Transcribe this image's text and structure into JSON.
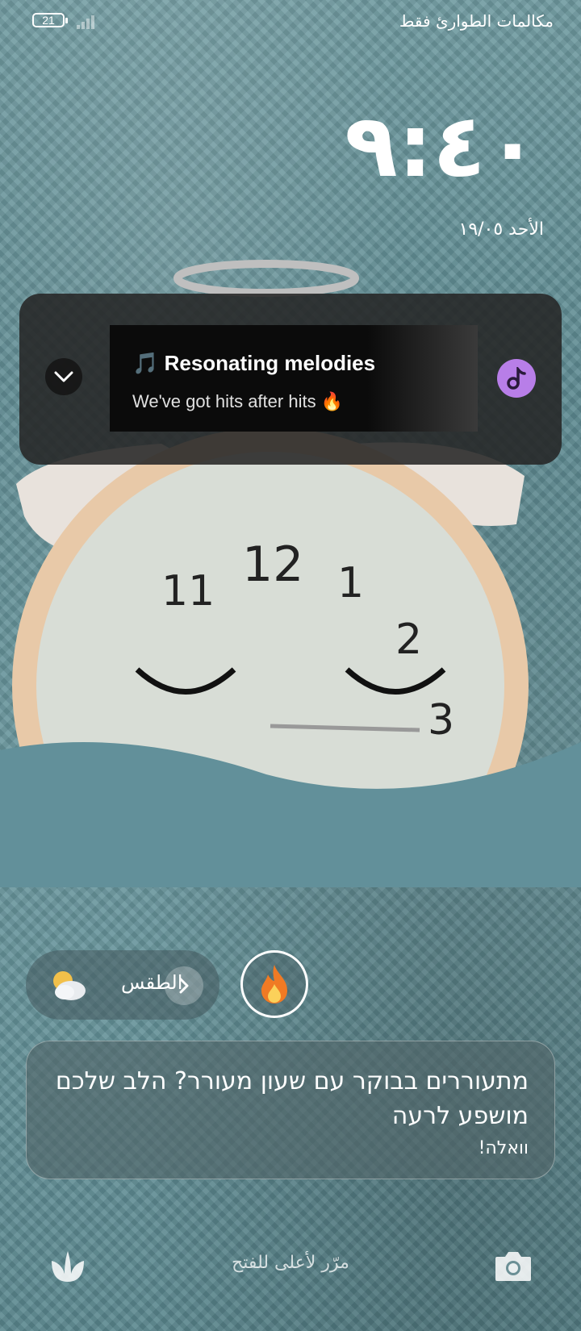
{
  "status_bar": {
    "battery_level": "21",
    "carrier_text": "مكالمات الطوارئ فقط"
  },
  "lock_screen": {
    "time": "٩:٤٠",
    "date": "الأحد ١٩/٠٥"
  },
  "media_player": {
    "title": "🎵 Resonating melodies",
    "subtitle": "We've got hits after hits 🔥",
    "accent_color": "#b87ee8"
  },
  "widgets": {
    "weather_label": "الطقس",
    "weather_icon": "partly-cloudy-icon",
    "shortcut_icon": "fire-icon"
  },
  "notification": {
    "text": "מתעוררים בבוקר עם שעון מעורר? הלב שלכם מושפע לרעה",
    "source": "וואלה!"
  },
  "bottom": {
    "unlock_hint": "مرّر لأعلى للفتح",
    "left_icon": "tulip-icon",
    "right_icon": "camera-icon"
  }
}
